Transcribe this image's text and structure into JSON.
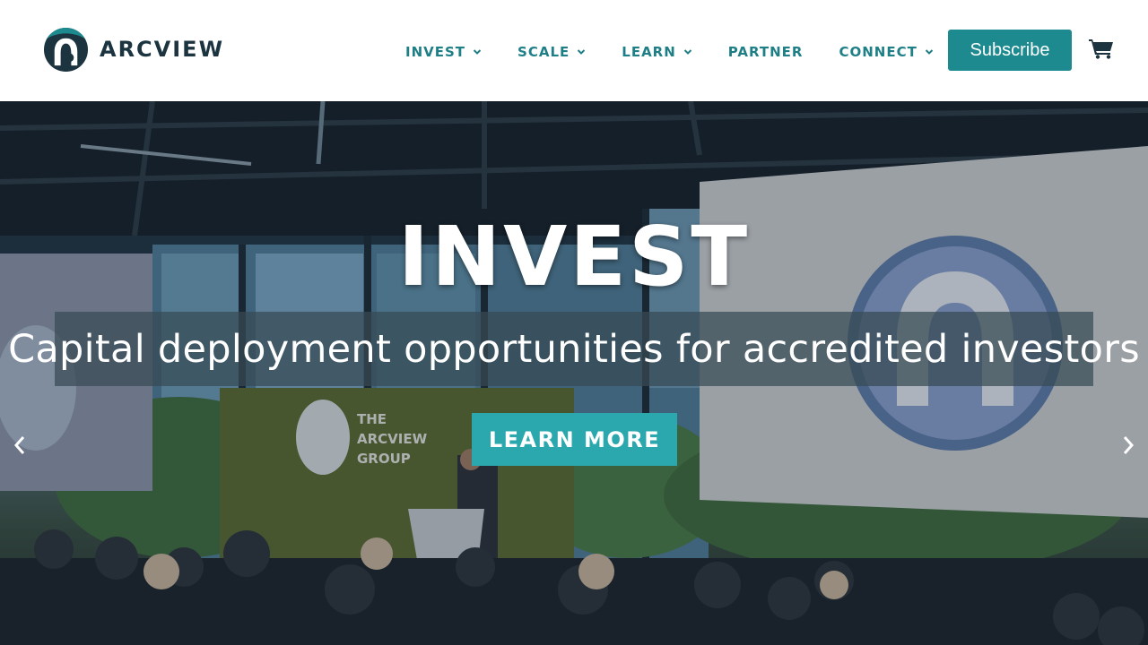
{
  "brand": {
    "name": "ARCVIEW",
    "logo_icon": "arcview-a-logo-icon",
    "colors": {
      "teal": "#1d8a8f",
      "nav_text": "#1f7f86",
      "dark": "#1c3340",
      "cta": "#2aa8ae"
    }
  },
  "nav": {
    "items": [
      {
        "label": "INVEST",
        "has_dropdown": true
      },
      {
        "label": "SCALE",
        "has_dropdown": true
      },
      {
        "label": "LEARN",
        "has_dropdown": true
      },
      {
        "label": "PARTNER",
        "has_dropdown": false
      },
      {
        "label": "CONNECT",
        "has_dropdown": true
      }
    ],
    "subscribe_label": "Subscribe",
    "cart_icon": "cart-icon"
  },
  "hero": {
    "title": "INVEST",
    "subtitle": "Capital deployment opportunities for accredited investors",
    "cta_label": "LEARN MORE",
    "prev_icon": "chevron-left-icon",
    "next_icon": "chevron-right-icon"
  }
}
